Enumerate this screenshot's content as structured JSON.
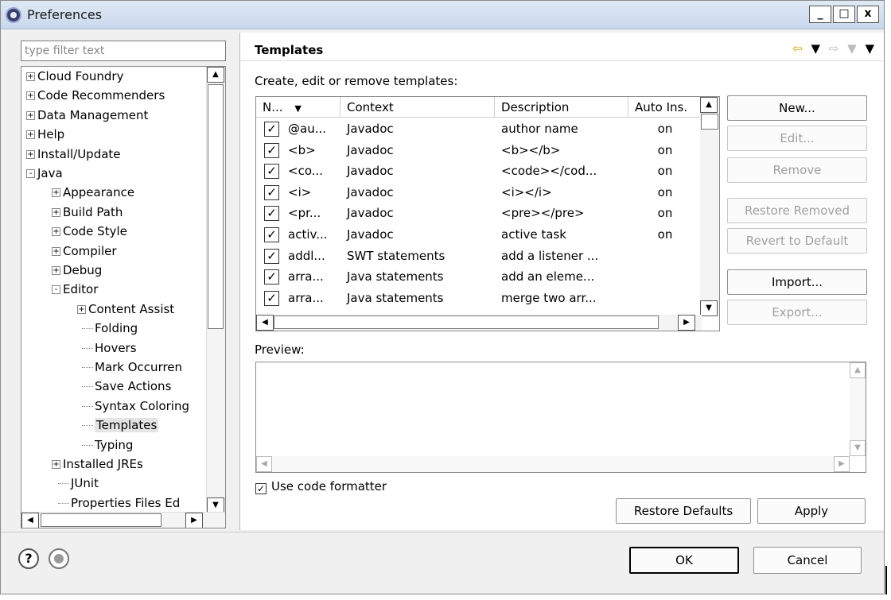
{
  "window": {
    "title": "Preferences",
    "controls": [
      "_",
      "□",
      "x"
    ]
  },
  "filter": {
    "placeholder": "type filter text"
  },
  "tree": [
    {
      "label": "Cloud Foundry",
      "state": "+"
    },
    {
      "label": "Code Recommenders",
      "state": "+"
    },
    {
      "label": "Data Management",
      "state": "+"
    },
    {
      "label": "Help",
      "state": "+"
    },
    {
      "label": "Install/Update",
      "state": "+"
    },
    {
      "label": "Java",
      "state": "-"
    },
    {
      "label": "Appearance",
      "state": "+"
    },
    {
      "label": "Build Path",
      "state": "+"
    },
    {
      "label": "Code Style",
      "state": "+"
    },
    {
      "label": "Compiler",
      "state": "+"
    },
    {
      "label": "Debug",
      "state": "+"
    },
    {
      "label": "Editor",
      "state": "-"
    },
    {
      "label": "Content Assist",
      "state": "+"
    },
    {
      "label": "Folding",
      "state": ""
    },
    {
      "label": "Hovers",
      "state": ""
    },
    {
      "label": "Mark Occurren",
      "state": ""
    },
    {
      "label": "Save Actions",
      "state": ""
    },
    {
      "label": "Syntax Coloring",
      "state": ""
    },
    {
      "label": "Templates",
      "state": ""
    },
    {
      "label": "Typing",
      "state": ""
    },
    {
      "label": "Installed JREs",
      "state": "+"
    },
    {
      "label": "JUnit",
      "state": ""
    },
    {
      "label": "Properties Files Ed",
      "state": ""
    }
  ],
  "page": {
    "title": "Templates",
    "description": "Create, edit or remove templates:",
    "nav": {
      "back": "⇦",
      "menu": "▼",
      "forward": "⇨"
    }
  },
  "table": {
    "headers": [
      "N...",
      "Context",
      "Description",
      "Auto Ins."
    ],
    "sort_icon": "▼",
    "rows": [
      {
        "name": "@au...",
        "context": "Javadoc",
        "description": "author name",
        "auto": "on",
        "checked": true
      },
      {
        "name": "<b>",
        "context": "Javadoc",
        "description": "<b></b>",
        "auto": "on",
        "checked": true
      },
      {
        "name": "<co...",
        "context": "Javadoc",
        "description": "<code></cod...",
        "auto": "on",
        "checked": true
      },
      {
        "name": "<i>",
        "context": "Javadoc",
        "description": "<i></i>",
        "auto": "on",
        "checked": true
      },
      {
        "name": "<pr...",
        "context": "Javadoc",
        "description": "<pre></pre>",
        "auto": "on",
        "checked": true
      },
      {
        "name": "activ...",
        "context": "Javadoc",
        "description": "active task",
        "auto": "on",
        "checked": true
      },
      {
        "name": "addl...",
        "context": "SWT statements",
        "description": "add a listener ...",
        "auto": "",
        "checked": true
      },
      {
        "name": "arra...",
        "context": "Java statements",
        "description": "add an eleme...",
        "auto": "",
        "checked": true
      },
      {
        "name": "arra...",
        "context": "Java statements",
        "description": "merge two arr...",
        "auto": "",
        "checked": true
      }
    ]
  },
  "buttons": {
    "new": "New...",
    "edit": "Edit...",
    "remove": "Remove",
    "restore_removed": "Restore Removed",
    "revert": "Revert to Default",
    "import": "Import...",
    "export": "Export...",
    "restore_defaults": "Restore Defaults",
    "apply": "Apply",
    "ok": "OK",
    "cancel": "Cancel"
  },
  "preview": {
    "label": "Preview:"
  },
  "formatter": {
    "label": "Use code formatter",
    "checked": true
  },
  "help": {
    "icon": "?"
  }
}
